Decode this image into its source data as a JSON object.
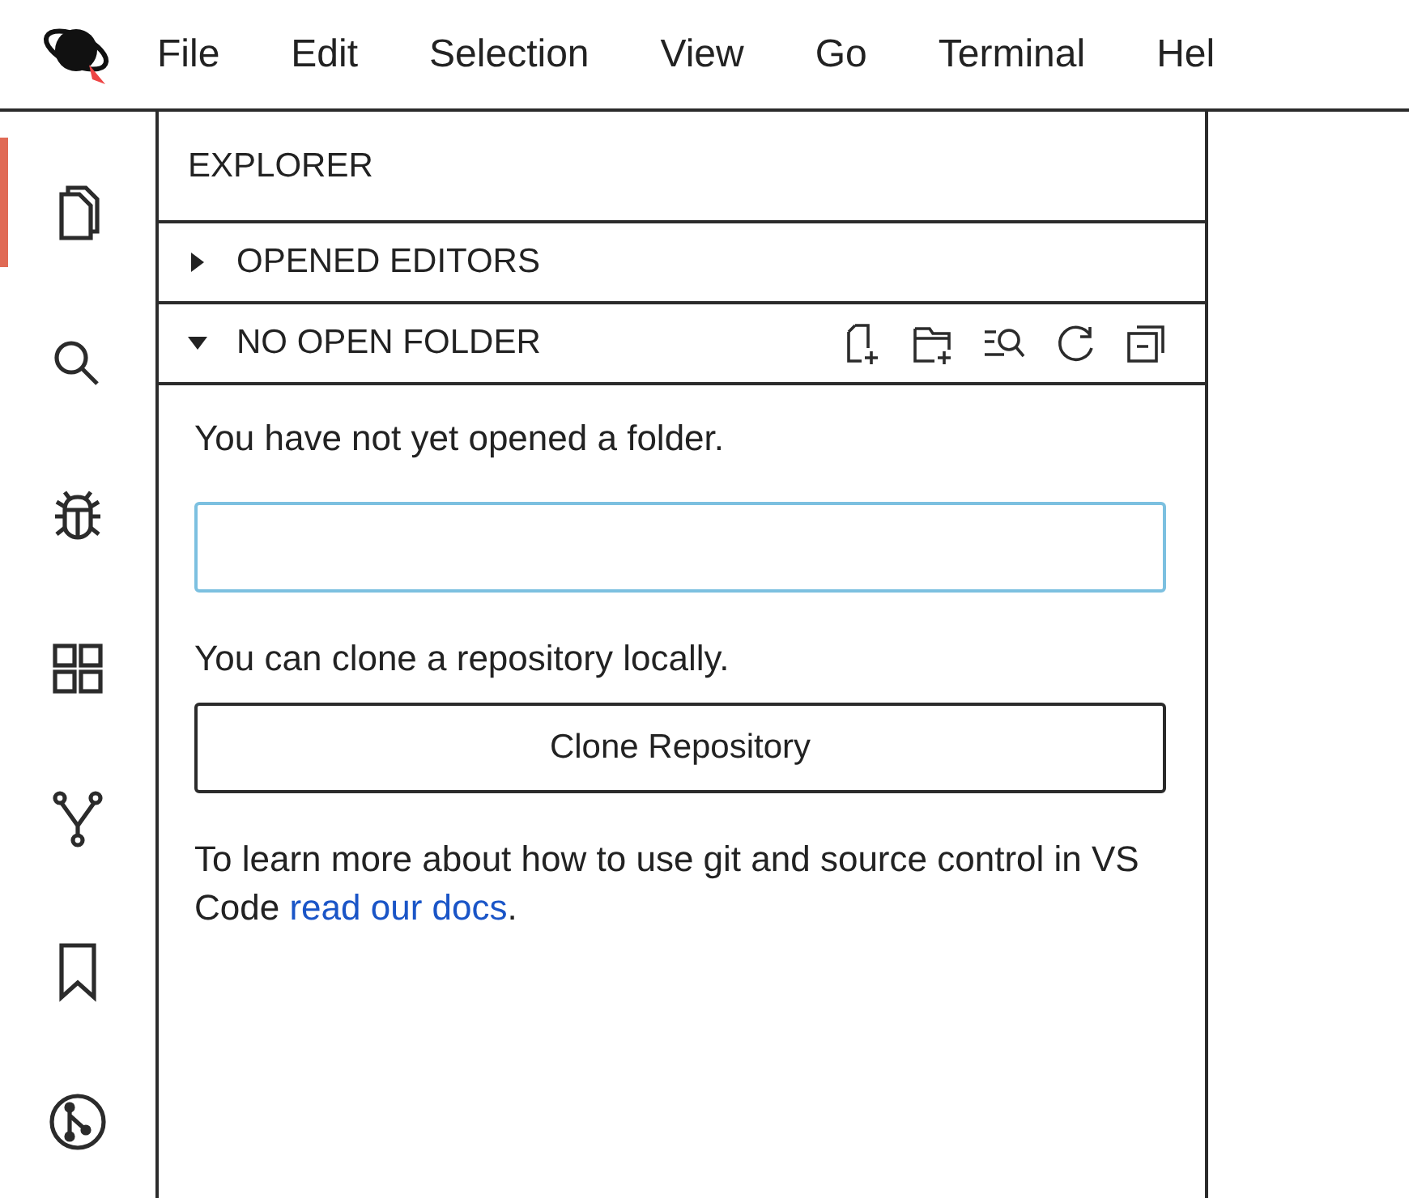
{
  "menu_bar": {
    "items": [
      "File",
      "Edit",
      "Selection",
      "View",
      "Go",
      "Terminal",
      "Hel"
    ]
  },
  "activity_bar": {
    "items": [
      {
        "kind": "files",
        "selected": true
      },
      {
        "kind": "search",
        "selected": false
      },
      {
        "kind": "debug",
        "selected": false
      },
      {
        "kind": "extensions",
        "selected": false
      },
      {
        "kind": "fork",
        "selected": false
      },
      {
        "kind": "bookmark",
        "selected": false
      },
      {
        "kind": "git",
        "selected": false
      }
    ]
  },
  "sidebar": {
    "title": "EXPLORER",
    "sections": [
      {
        "title": "OPENED EDITORS",
        "expanded": false
      },
      {
        "title": "NO OPEN FOLDER",
        "expanded": true
      }
    ],
    "message": "You have not yet opened a folder.",
    "clone_message": "You can clone a repository locally.",
    "clone_button": "Clone Repository",
    "docs_text": "To learn more about how to use git and source control in VS Code ",
    "docs_link": "read our docs",
    "docs_end": "."
  }
}
